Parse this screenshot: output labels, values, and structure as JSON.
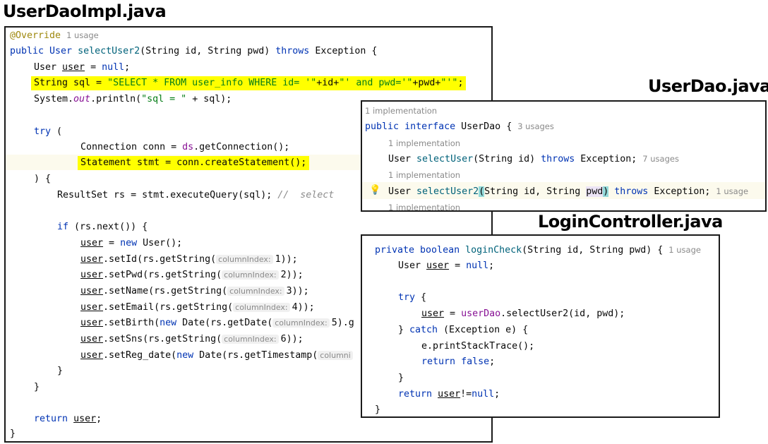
{
  "titles": {
    "userDaoImpl": "UserDaoImpl.java",
    "userDao": "UserDao.java",
    "loginController": "LoginController.java"
  },
  "impl": {
    "annotation": "@Override",
    "override_usage": "1 usage",
    "sig_pre": "public User ",
    "sig_method": "selectUser2",
    "sig_params": "(String id, String pwd) ",
    "sig_throws": "throws",
    "sig_post": " Exception {",
    "l_user_type": "User ",
    "l_user_var": "user",
    "l_user_eq": " = ",
    "l_null": "null",
    "l_semi": ";",
    "sql_type": "String sql = ",
    "sql_str1": "\"SELECT * FROM user_info WHERE id= '\"",
    "sql_mid1": "+id+",
    "sql_str2": "\"' and pwd='\"",
    "sql_mid2": "+pwd+",
    "sql_str3": "\"'\"",
    "sql_end": ";",
    "println_pre": "System.",
    "println_out": "out",
    "println_mid": ".println(",
    "println_str": "\"sql = \"",
    "println_end": " + sql);",
    "try_kw": "try",
    "try_paren": " (",
    "conn_pre": "Connection conn = ",
    "conn_ds": "ds",
    "conn_post": ".getConnection();",
    "stmt_line": "Statement stmt = conn.createStatement();",
    "close_paren": ") {",
    "rs_line": "ResultSet rs = stmt.executeQuery(sql); ",
    "rs_comment": "//  select",
    "if_kw": "if",
    "if_rest": " (rs.next()) {",
    "new_kw": "new",
    "new_user_rest": " User();",
    "inlay_label": "columnIndex:",
    "set_id": ".setId(rs.getString(",
    "set_pwd": ".setPwd(rs.getString(",
    "set_name": ".setName(rs.getString(",
    "set_email": ".setEmail(rs.getString(",
    "set_birth_a": ".setBirth(",
    "set_birth_b": " Date(rs.getDate(",
    "set_birth_c": "5).g",
    "set_sns": ".setSns(rs.getString(",
    "set_reg_a": ".setReg_date(",
    "set_reg_b": " Date(rs.getTimestamp(",
    "set_reg_inlay": "columni",
    "n1": "1));",
    "n2": "2));",
    "n3": "3));",
    "n4": "4));",
    "n6": "6));",
    "close_brace": "}",
    "return_kw": "return",
    "return_rest": ";"
  },
  "dao": {
    "impl_hint": "1 implementation",
    "decl_public": "public",
    "decl_interface": "interface",
    "decl_name": " UserDao ",
    "decl_brace": "{",
    "decl_usage": "3 usages",
    "m1_type": "User ",
    "m1_name": "selectUser",
    "m1_params": "(String id) ",
    "m1_throws": "throws",
    "m1_end": " Exception;",
    "m1_usage": "7 usages",
    "m2_type": "User ",
    "m2_name": "selectUser2",
    "m2_paren": "(",
    "m2_params_a": "String id, String ",
    "m2_pwd": "pwd",
    "m2_paren2": ")",
    "m2_throws": "throws",
    "m2_end": " Exception;",
    "m2_usage": "1 usage",
    "bulb_icon": "lightbulb-icon"
  },
  "login": {
    "sig_kw": "private boolean",
    "sig_method": " loginCheck",
    "sig_params": "(String id, String pwd) {",
    "sig_usage": "1 usage",
    "user_type": "User ",
    "user_var": "user",
    "user_eq": " = ",
    "null_kw": "null",
    "semi": ";",
    "try_kw": "try",
    "try_brace": " {",
    "assign_eq": " = ",
    "userdao": "userDao",
    "assign_call": ".selectUser2(id, pwd);",
    "catch_close": "} ",
    "catch_kw": "catch",
    "catch_rest": " (Exception e) {",
    "print_trace": "e.printStackTrace();",
    "return_kw": "return",
    "false_kw": "false",
    "close_brace": "}",
    "return_user_rest": "!=",
    "return_null": "null"
  }
}
